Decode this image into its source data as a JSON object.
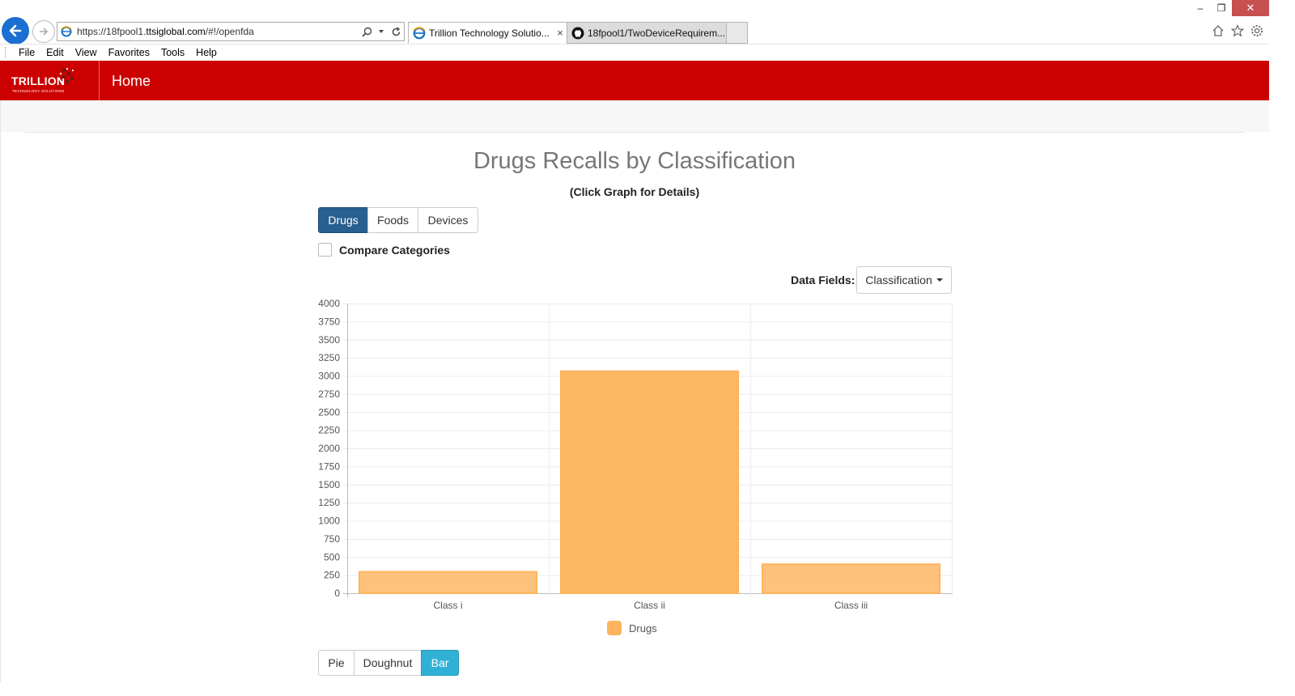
{
  "browser": {
    "url_prefix": "https://18fpool1.",
    "url_domain": "ttsiglobal.com",
    "url_suffix": "/#!/openfda",
    "tabs": [
      {
        "title": "Trillion Technology Solutio...",
        "close": "×"
      },
      {
        "title": "18fpool1/TwoDeviceRequirem..."
      }
    ],
    "menu": [
      "File",
      "Edit",
      "View",
      "Favorites",
      "Tools",
      "Help"
    ],
    "window_controls": {
      "minimize": "–",
      "restore": "❐",
      "close": "✕"
    }
  },
  "header": {
    "brand_name": "TRILLION",
    "brand_sub": "TECHNOLOGY SOLUTIONS",
    "home_label": "Home",
    "color": "#cc0000"
  },
  "page": {
    "title": "Drugs Recalls by Classification",
    "subtitle": "(Click Graph for Details)",
    "category_buttons": [
      {
        "label": "Drugs",
        "active": true
      },
      {
        "label": "Foods",
        "active": false
      },
      {
        "label": "Devices",
        "active": false
      }
    ],
    "compare_label": "Compare Categories",
    "compare_checked": false,
    "data_fields_label": "Data Fields:",
    "data_fields_value": "Classification",
    "chart_type_buttons": [
      {
        "label": "Pie",
        "active": false
      },
      {
        "label": "Doughnut",
        "active": false
      },
      {
        "label": "Bar",
        "active": true
      }
    ]
  },
  "chart_data": {
    "type": "bar",
    "categories": [
      "Class i",
      "Class ii",
      "Class iii"
    ],
    "series": [
      {
        "name": "Drugs",
        "values": [
          295,
          3065,
          400
        ],
        "color": "#fdb45c"
      }
    ],
    "ylim": [
      0,
      4000
    ],
    "yticks": [
      0,
      250,
      500,
      750,
      1000,
      1250,
      1500,
      1750,
      2000,
      2250,
      2500,
      2750,
      3000,
      3250,
      3500,
      3750,
      4000
    ],
    "grid": true,
    "legend": "bottom"
  }
}
